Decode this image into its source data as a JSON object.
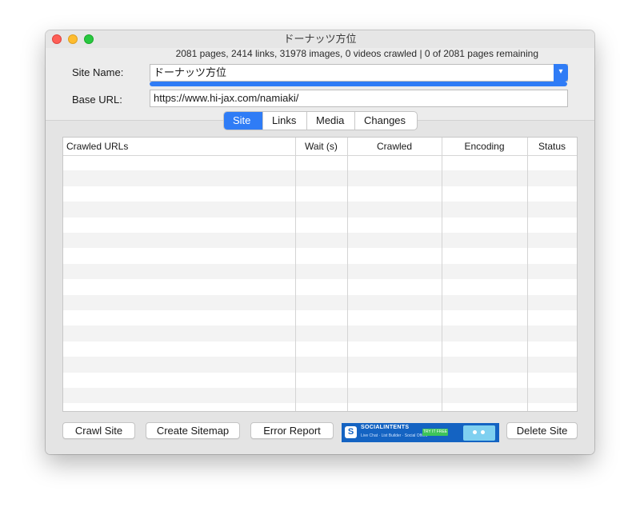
{
  "window": {
    "title": "ドーナッツ方位"
  },
  "status_line": "2081 pages, 2414 links, 31978 images, 0 videos crawled | 0 of 2081 pages remaining",
  "form": {
    "site_name_label": "Site Name:",
    "site_name_value": "ドーナッツ方位",
    "base_url_label": "Base URL:",
    "base_url_value": "https://www.hi-jax.com/namiaki/",
    "progress_fraction": 1.0
  },
  "tabs": [
    "Site",
    "Links",
    "Media",
    "Changes"
  ],
  "active_tab": "Site",
  "table": {
    "columns": [
      "Crawled URLs",
      "Wait (s)",
      "Crawled",
      "Encoding",
      "Status"
    ],
    "rows": []
  },
  "buttons": {
    "crawl_site": "Crawl Site",
    "create_sitemap": "Create Sitemap",
    "error_report": "Error Report",
    "delete_site": "Delete Site"
  },
  "ad": {
    "brand": "SOCIALINTENTS",
    "tagline": "Live Chat · List Builder · Social Offers",
    "cta": "TRY IT FREE"
  },
  "colors": {
    "accent": "#2f7cf6",
    "ad_background": "#1463c2",
    "ad_cta": "#3ec45a"
  },
  "icons": {
    "combo_arrow": "chevron-down-icon",
    "ad_logo": "socialintents-logo-icon"
  }
}
